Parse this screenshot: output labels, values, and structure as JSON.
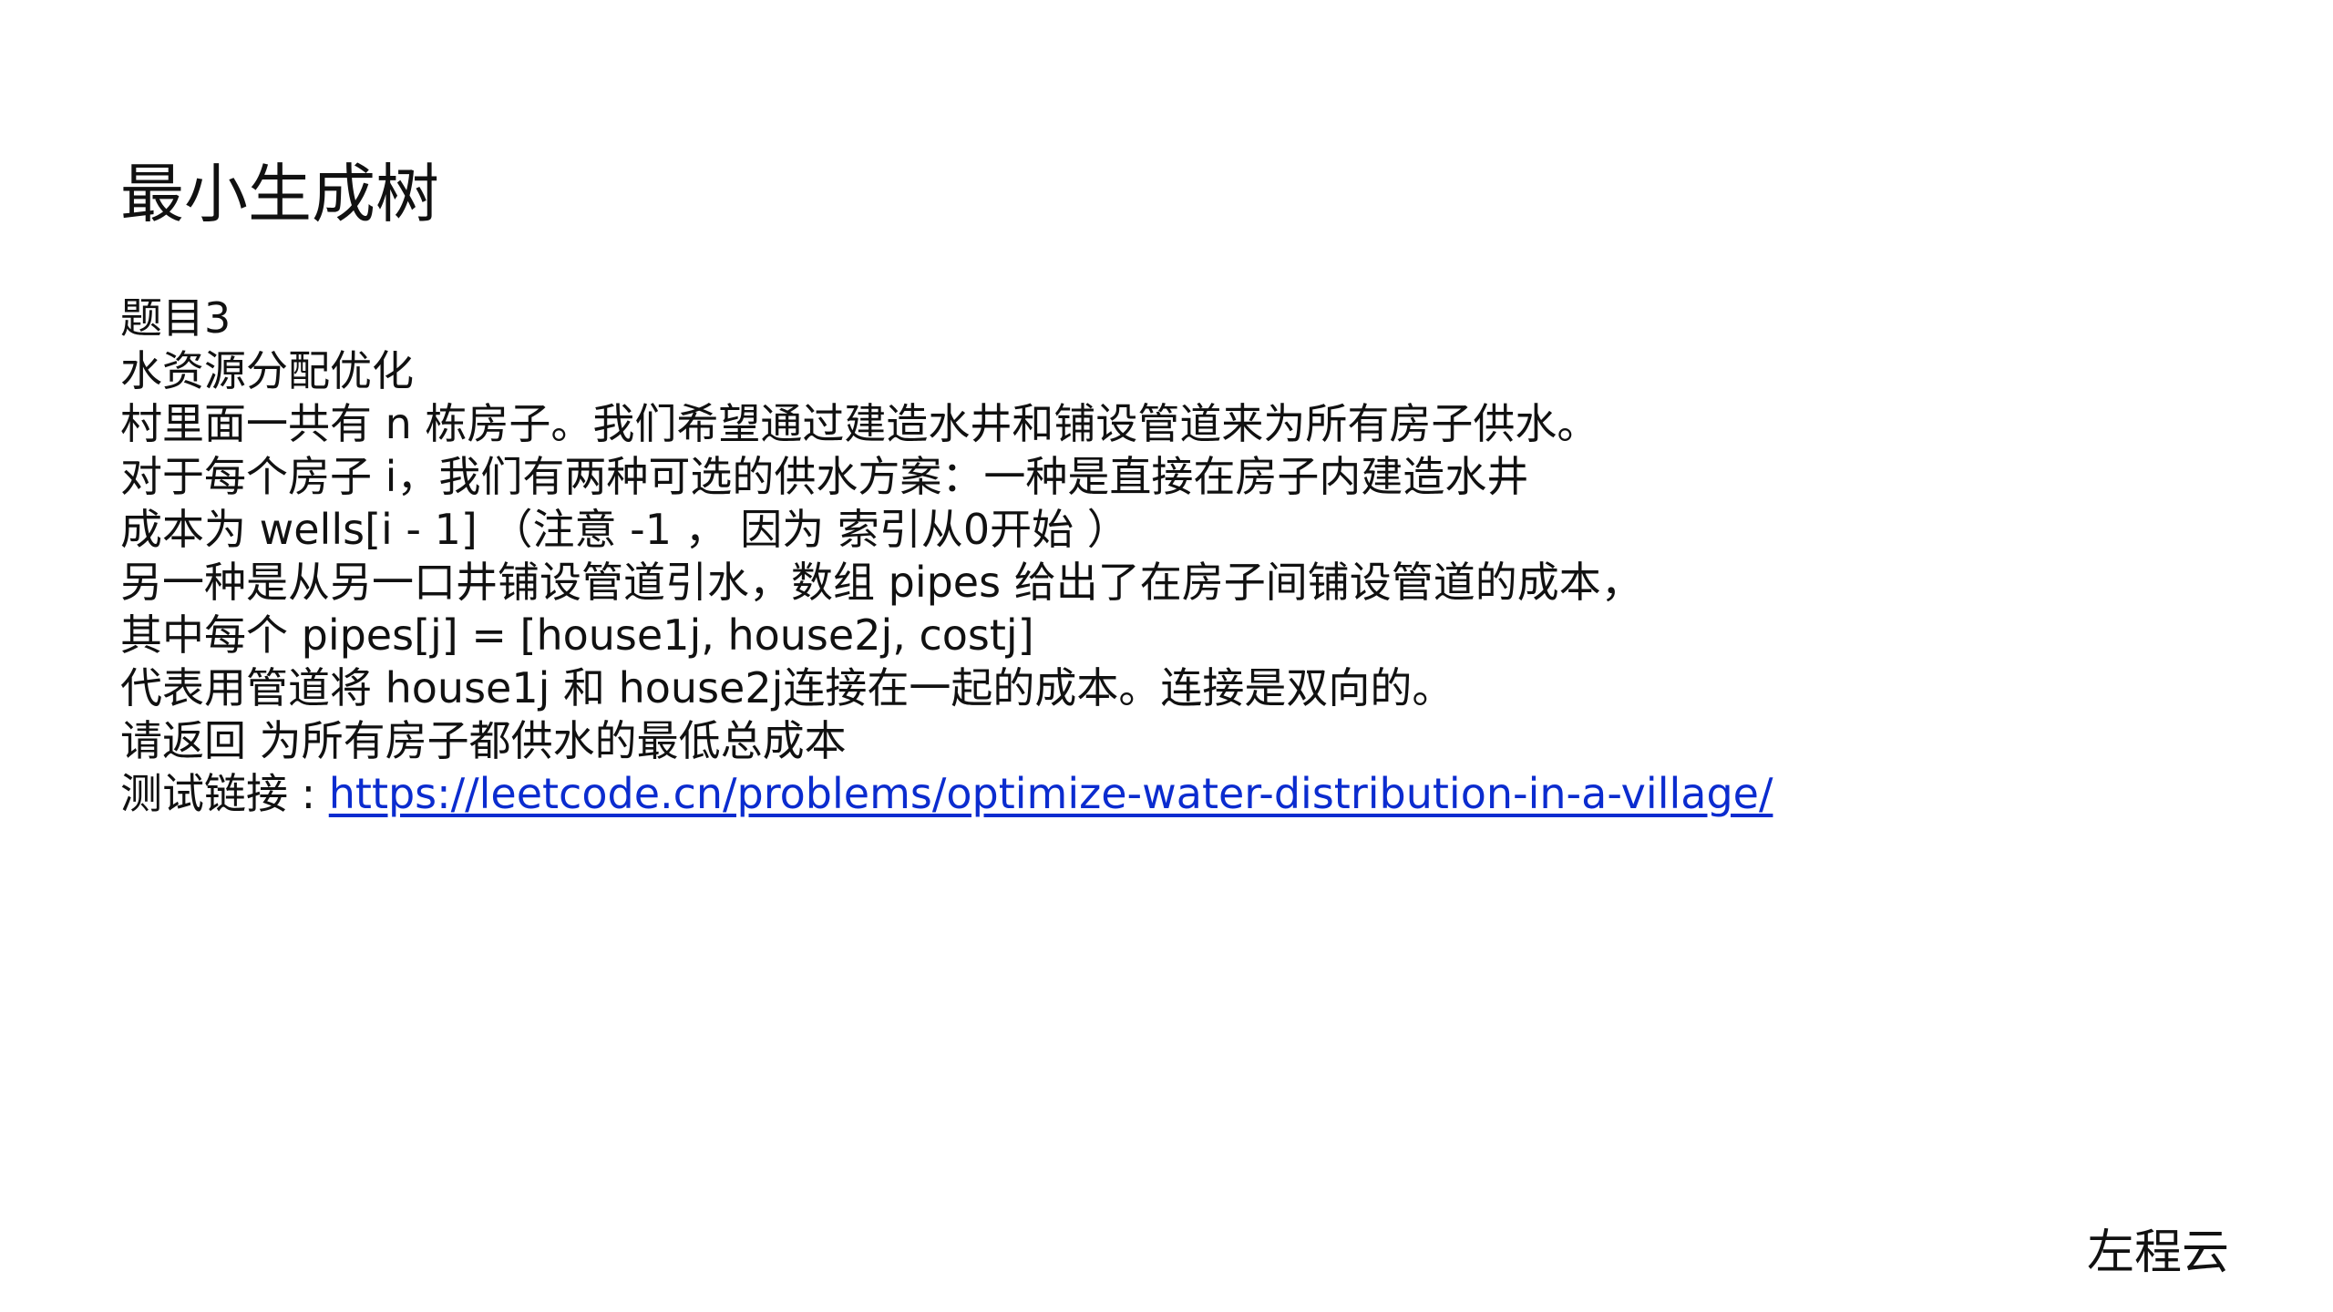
{
  "slide": {
    "title": "最小生成树",
    "lines": [
      "题目3",
      "水资源分配优化",
      "村里面一共有 n 栋房子。我们希望通过建造水井和铺设管道来为所有房子供水。",
      "对于每个房子 i，我们有两种可选的供水方案：一种是直接在房子内建造水井",
      "成本为 wells[i - 1] （注意 -1 ， 因为 索引从0开始 ）",
      "另一种是从另一口井铺设管道引水，数组 pipes 给出了在房子间铺设管道的成本，",
      "其中每个 pipes[j] = [house1j, house2j, costj]",
      "代表用管道将 house1j 和 house2j连接在一起的成本。连接是双向的。",
      "请返回 为所有房子都供水的最低总成本"
    ],
    "test_link_label": "测试链接 : ",
    "test_link_url": "https://leetcode.cn/problems/optimize-water-distribution-in-a-village/",
    "footer": "左程云"
  },
  "colors": {
    "text": "#111111",
    "link": "#0b2ccf",
    "background": "#ffffff"
  }
}
